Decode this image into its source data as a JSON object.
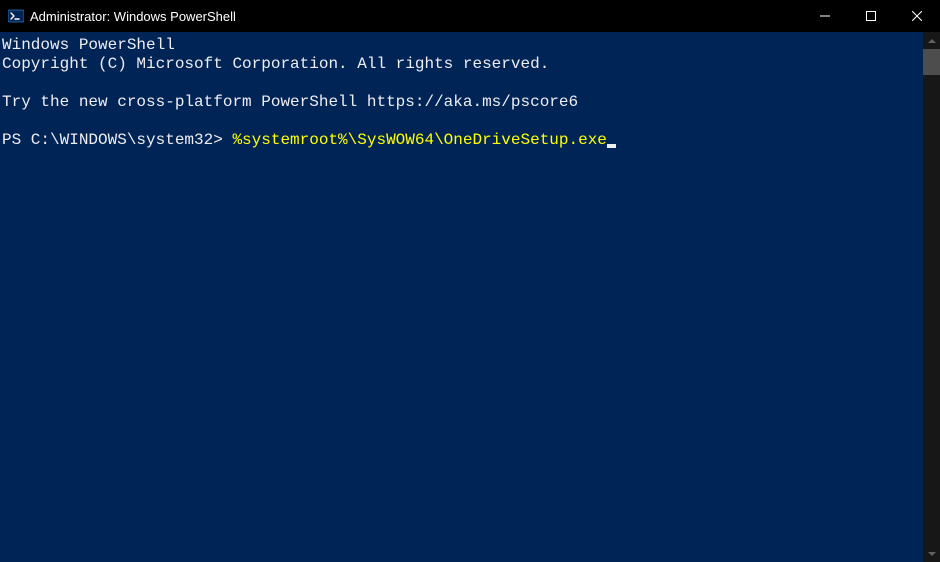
{
  "titlebar": {
    "title": "Administrator: Windows PowerShell"
  },
  "terminal": {
    "banner_line1": "Windows PowerShell",
    "banner_line2": "Copyright (C) Microsoft Corporation. All rights reserved.",
    "banner_line3": "Try the new cross-platform PowerShell https://aka.ms/pscore6",
    "prompt": "PS C:\\WINDOWS\\system32> ",
    "command": "%systemroot%\\SysWOW64\\OneDriveSetup.exe"
  },
  "colors": {
    "terminal_bg": "#012456",
    "terminal_fg": "#eeedf0",
    "command_fg": "#ffff00",
    "titlebar_bg": "#000000"
  }
}
